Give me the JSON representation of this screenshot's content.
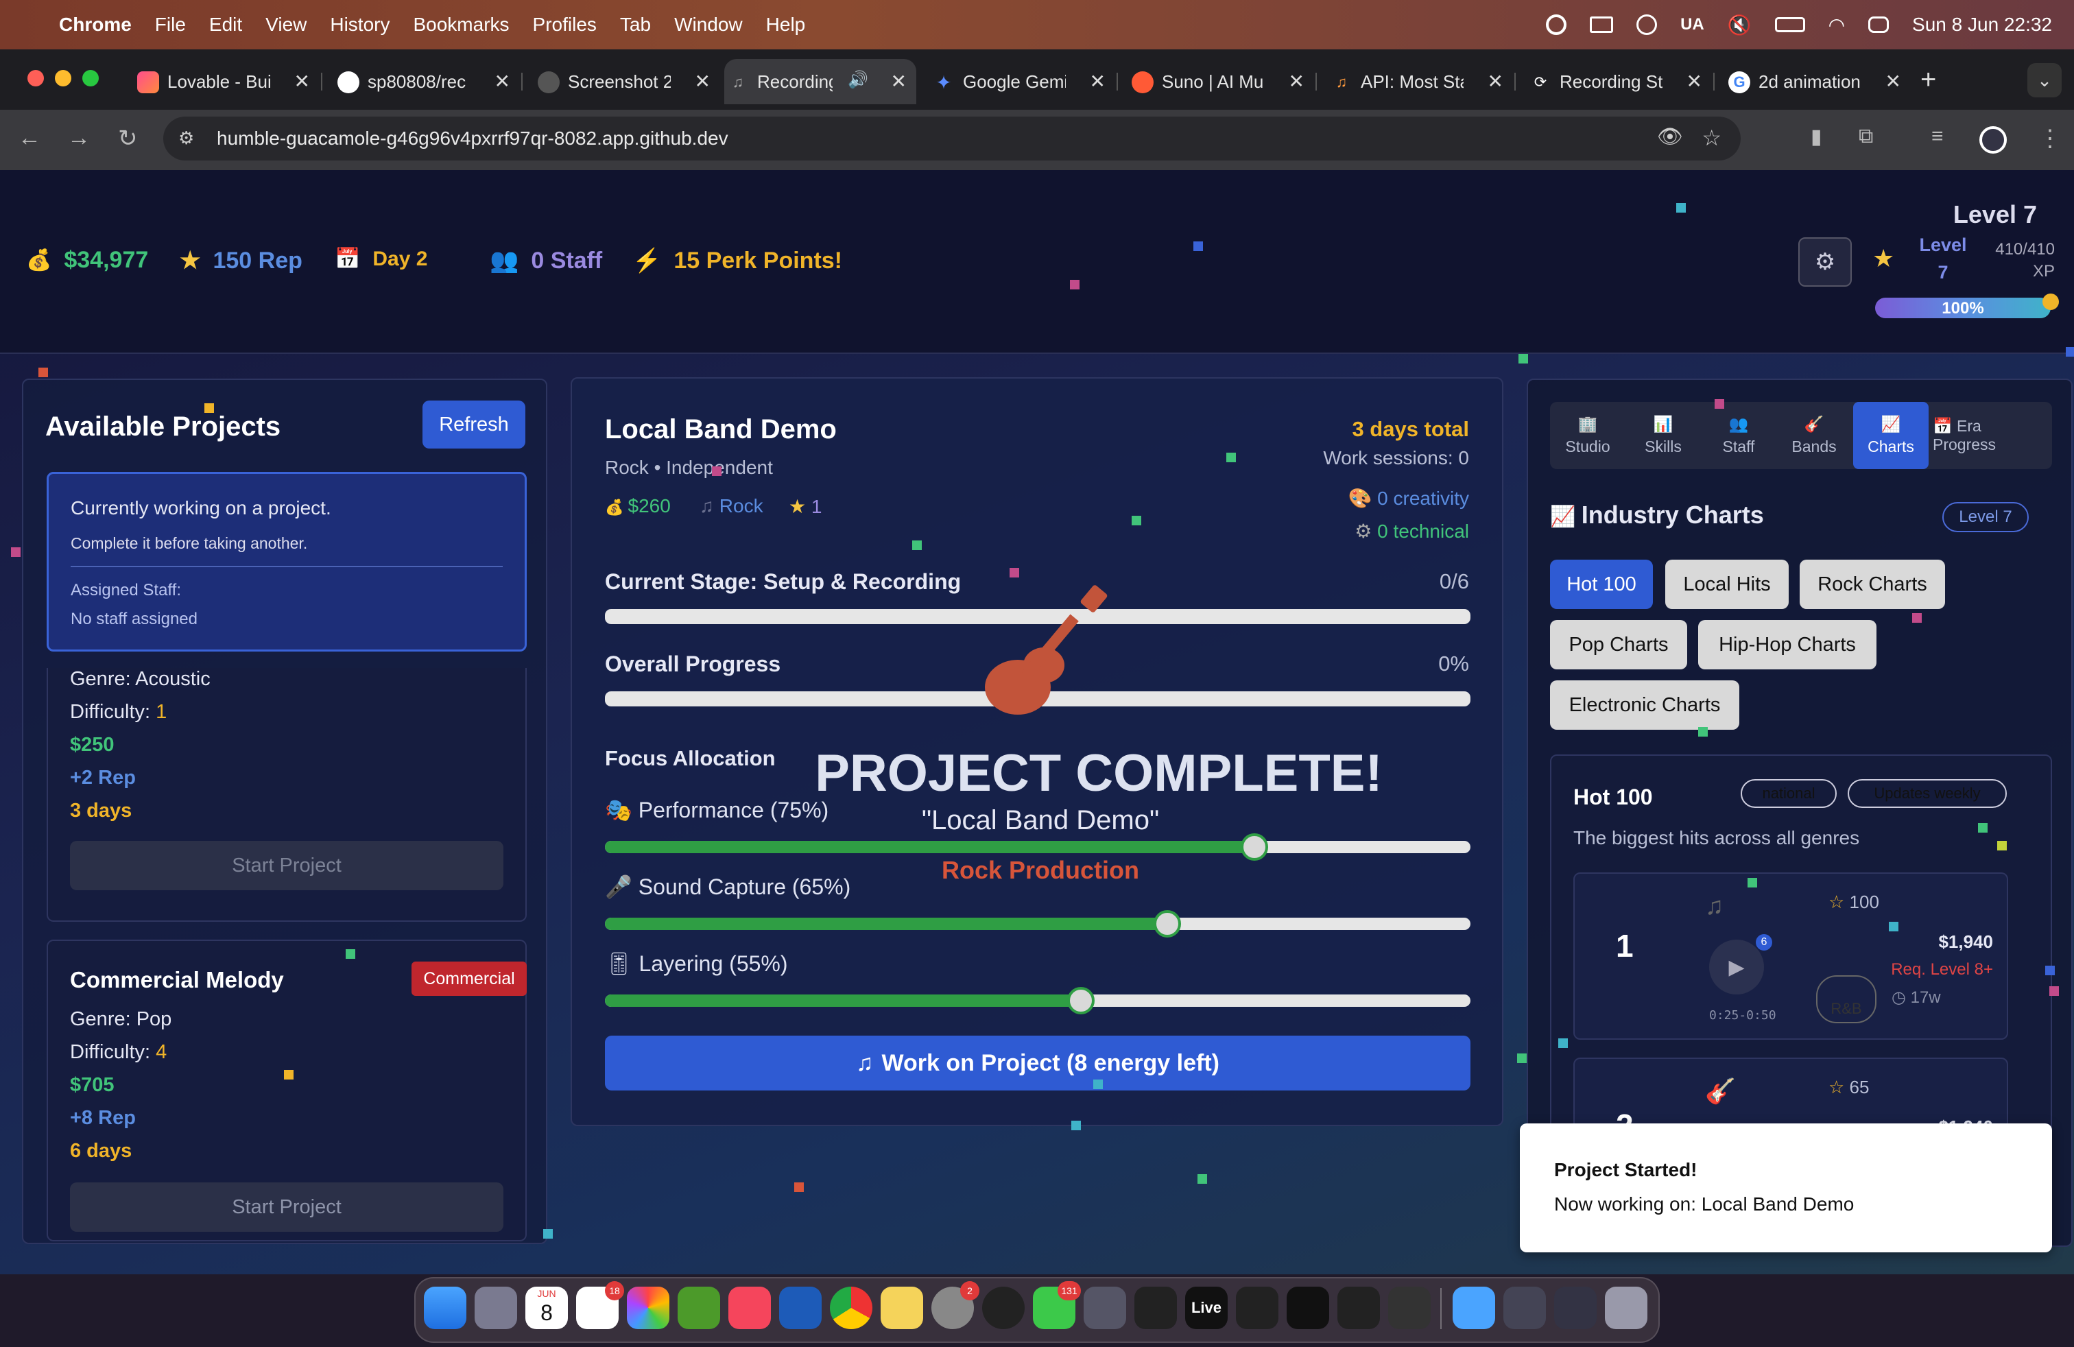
{
  "menubar": {
    "app": "Chrome",
    "items": [
      "File",
      "Edit",
      "View",
      "History",
      "Bookmarks",
      "Profiles",
      "Tab",
      "Window",
      "Help"
    ],
    "lang": "UA",
    "datetime": "Sun 8 Jun  22:32"
  },
  "tabs": [
    {
      "title": "Lovable - Bui",
      "icon": "lovable-icon"
    },
    {
      "title": "sp80808/rec",
      "icon": "github-icon"
    },
    {
      "title": "Screenshot 2",
      "icon": "github-icon"
    },
    {
      "title": "Recording",
      "icon": "music-icon"
    },
    {
      "title": "Google Gemi",
      "icon": "gemini-icon"
    },
    {
      "title": "Suno | AI Mu",
      "icon": "suno-icon"
    },
    {
      "title": "API: Most Sta",
      "icon": "music-icon"
    },
    {
      "title": "Recording St",
      "icon": "refresh-icon"
    },
    {
      "title": "2d animation",
      "icon": "google-icon"
    }
  ],
  "address": {
    "url": "humble-guacamole-g46g96v4pxrrf97qr-8082.app.github.dev"
  },
  "header": {
    "money": "$34,977",
    "rep": "150 Rep",
    "day": "Day 2",
    "staff": "0 Staff",
    "perks": "15 Perk Points!",
    "level_title": "Level 7",
    "level_small_1": "Level",
    "level_small_2": "7",
    "xp_1": "410/410",
    "xp_2": "XP",
    "xp_percent_label": "100%",
    "xp_fraction": 1.0
  },
  "projects": {
    "title": "Available Projects",
    "refresh": "Refresh",
    "current": {
      "line1": "Currently working on a project.",
      "line2": "Complete it before taking another.",
      "staff_label": "Assigned Staff:",
      "staff_value": "No staff assigned"
    },
    "card1": {
      "genre": "Genre: Acoustic",
      "difficulty_label": "Difficulty: ",
      "difficulty": "1",
      "pay": "$250",
      "rep": "+2 Rep",
      "days": "3 days",
      "start": "Start Project"
    },
    "card2": {
      "title": "Commercial Melody",
      "badge": "Commercial",
      "genre": "Genre: Pop",
      "difficulty_label": "Difficulty: ",
      "difficulty": "4",
      "pay": "$705",
      "rep": "+8 Rep",
      "days": "6 days",
      "start": "Start Project"
    }
  },
  "project": {
    "title": "Local Band Demo",
    "subtitle": "Rock • Independent",
    "pay": "$260",
    "genre": "Rock",
    "stars": "1",
    "total": "3 days total",
    "sessions": "Work sessions: 0",
    "creativity": "0 creativity",
    "technical": "0 technical",
    "stage_label": "Current Stage: Setup & Recording",
    "stage_count": "0/6",
    "stage_fraction": 0,
    "overall_label": "Overall Progress",
    "overall_value": "0%",
    "overall_fraction": 0,
    "focus_label": "Focus Allocation",
    "overlay_title": "PROJECT COMPLETE!",
    "overlay_name": "\"Local Band Demo\"",
    "overlay_genre": "Rock Production",
    "sliders": [
      {
        "label": "Performance (75%)",
        "value": 75
      },
      {
        "label": "Sound Capture (65%)",
        "value": 65
      },
      {
        "label": "Layering (55%)",
        "value": 55
      }
    ],
    "work_button": "Work on Project (8 energy left)"
  },
  "sidebar": {
    "tabs": [
      {
        "icon": "🏢",
        "label": "Studio"
      },
      {
        "icon": "📊",
        "label": "Skills"
      },
      {
        "icon": "👥",
        "label": "Staff"
      },
      {
        "icon": "🎸",
        "label": "Bands"
      },
      {
        "icon": "📈",
        "label": "Charts"
      },
      {
        "icon": "📅",
        "label": "Era Progress"
      }
    ],
    "charts_title": "Industry Charts",
    "level_badge": "Level 7",
    "chart_filters": [
      "Hot 100",
      "Local Hits",
      "Rock Charts",
      "Pop Charts",
      "Hip-Hop Charts",
      "Electronic Charts"
    ],
    "hot100": {
      "title": "Hot 100",
      "badge1": "national",
      "badge2": "Updates weekly",
      "desc": "The biggest hits across all genres",
      "entry1": {
        "rank": "1",
        "score": "100",
        "price": "$1,940",
        "req": "Req. Level 8+",
        "weeks": "17w",
        "time": "0:25-0:50",
        "genre": "R&B",
        "dot": "6"
      },
      "entry2": {
        "rank": "2",
        "score": "65",
        "price": "$1,940"
      }
    }
  },
  "toast": {
    "title": "Project Started!",
    "body": "Now working on: Local Band Demo"
  },
  "dock": {
    "calendar_month": "JUN",
    "calendar_day": "8",
    "badge_reminders": "18",
    "badge_settings": "2",
    "badge_messages": "131",
    "live": "Live"
  }
}
